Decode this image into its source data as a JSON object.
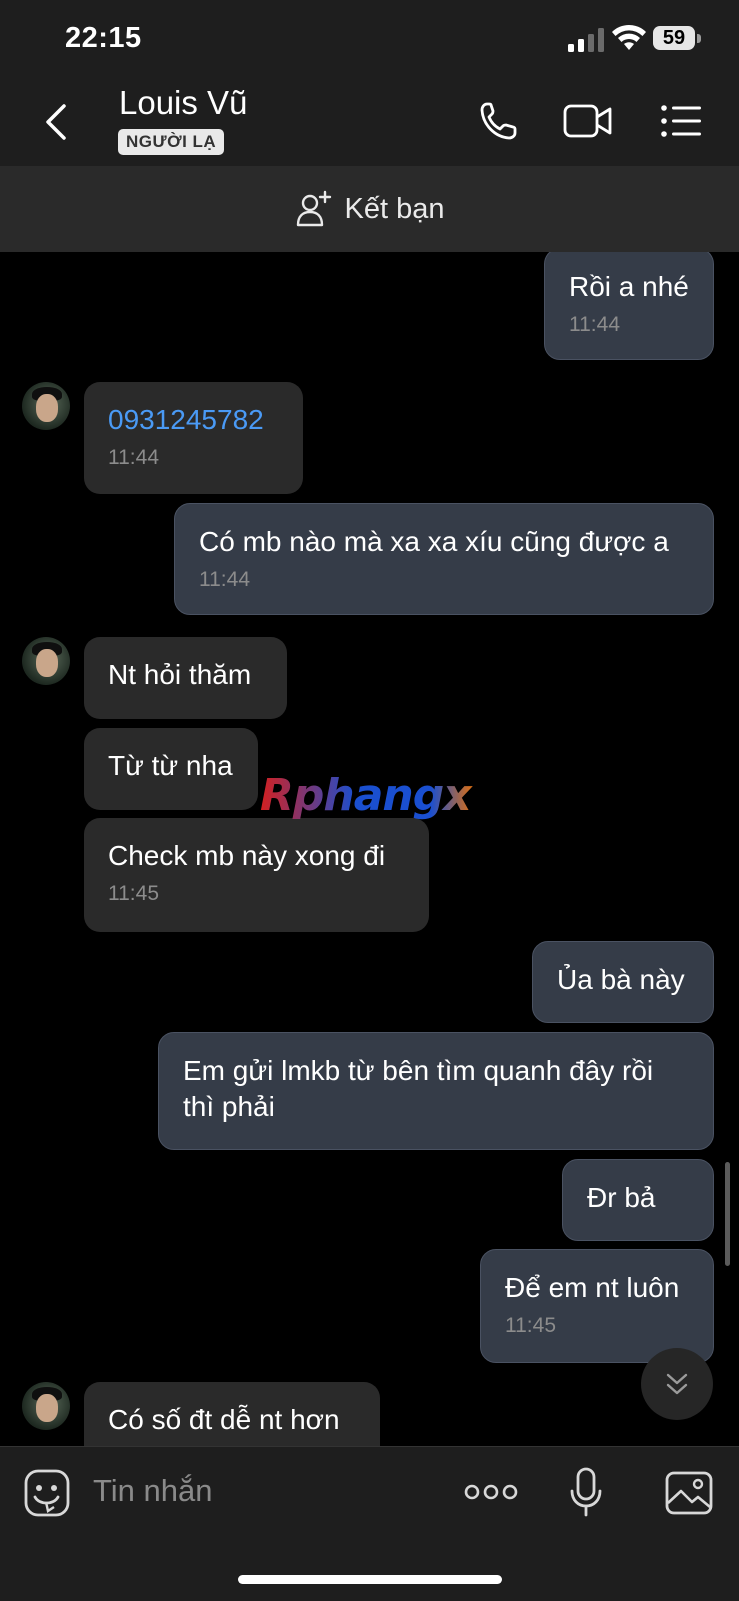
{
  "status_bar": {
    "time": "22:15",
    "battery": "59"
  },
  "header": {
    "contact_name": "Louis Vũ",
    "badge": "NGƯỜI LẠ"
  },
  "friend_bar": {
    "label": "Kết bạn"
  },
  "messages": [
    {
      "dir": "out",
      "text": "Rồi a nhé",
      "time": "11:44"
    },
    {
      "dir": "in",
      "text": "0931245782",
      "time": "11:44",
      "is_link": true
    },
    {
      "dir": "out",
      "text": "Có mb nào mà xa xa xíu cũng được a",
      "time": "11:44"
    },
    {
      "dir": "in",
      "text": "Nt hỏi thăm",
      "time": ""
    },
    {
      "dir": "in",
      "text": "Từ từ nha",
      "time": ""
    },
    {
      "dir": "in",
      "text": "Check mb này xong đi",
      "time": "11:45"
    },
    {
      "dir": "out",
      "text": "Ủa bà này",
      "time": ""
    },
    {
      "dir": "out",
      "text": "Em gửi lmkb từ bên tìm quanh đây rồi thì phải",
      "time": ""
    },
    {
      "dir": "out",
      "text": "Đr bả",
      "time": ""
    },
    {
      "dir": "out",
      "text": "Để em nt luôn",
      "time": "11:45"
    },
    {
      "dir": "in",
      "text": "Có số đt dễ nt hơn",
      "time": ""
    }
  ],
  "watermark": "Rphangx",
  "input": {
    "placeholder": "Tin nhắn"
  },
  "icons": {
    "header": [
      "back-icon",
      "phone-icon",
      "video-call-icon",
      "menu-list-icon"
    ],
    "friend_bar": "add-friend-icon",
    "input": [
      "sticker-icon",
      "more-icon",
      "microphone-icon",
      "image-icon"
    ],
    "jump": "chevron-double-down-icon"
  },
  "colors": {
    "link": "#4a9af5",
    "outgoing_bubble": "#353c48",
    "incoming_bubble": "#2a2a2a"
  }
}
